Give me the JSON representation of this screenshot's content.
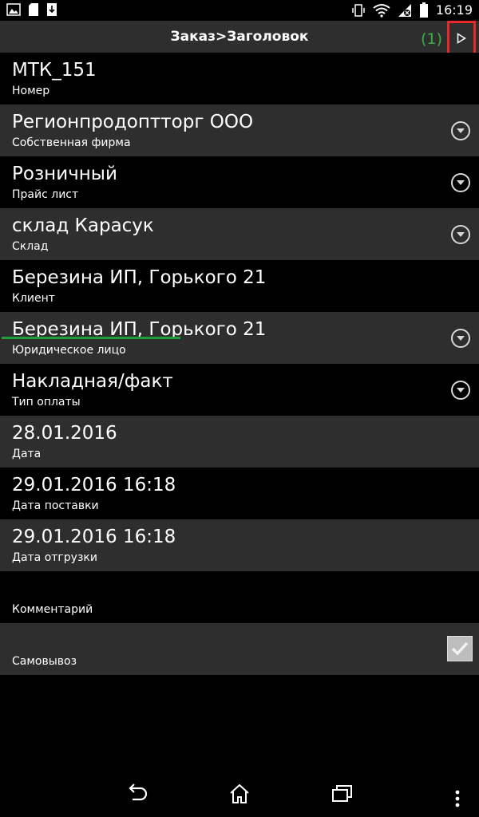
{
  "status_bar": {
    "time": "16:19"
  },
  "header": {
    "title": "Заказ>Заголовок",
    "counter": "(1)",
    "next_icon": "play-triangle-icon"
  },
  "fields": [
    {
      "value": "МТК_151",
      "label": "Номер",
      "dropdown": false
    },
    {
      "value": "Регионпродоптторг ООО",
      "label": "Собственная фирма",
      "dropdown": true
    },
    {
      "value": "Розничный",
      "label": "Прайс лист",
      "dropdown": true
    },
    {
      "value": "склад Карасук",
      "label": "Склад",
      "dropdown": true
    },
    {
      "value": "Березина ИП, Горького 21",
      "label": "Клиент",
      "dropdown": false
    },
    {
      "value": "Березина ИП, Горького 21",
      "label": "Юридическое лицо",
      "dropdown": true
    },
    {
      "value": "Накладная/факт",
      "label": "Тип оплаты",
      "dropdown": true
    },
    {
      "value": "28.01.2016",
      "label": "Дата",
      "dropdown": false
    },
    {
      "value": "29.01.2016 16:18",
      "label": "Дата поставки",
      "dropdown": false
    },
    {
      "value": "29.01.2016 16:18",
      "label": "Дата отгрузки",
      "dropdown": false
    },
    {
      "value": "",
      "label": "Комментарий",
      "dropdown": false
    },
    {
      "value": "",
      "label": "Самовывоз",
      "checkbox": true,
      "checked": true
    }
  ],
  "colors": {
    "accent_green": "#3cb043",
    "highlight_red": "#e8282a",
    "row_gray": "#2e2e2e"
  }
}
